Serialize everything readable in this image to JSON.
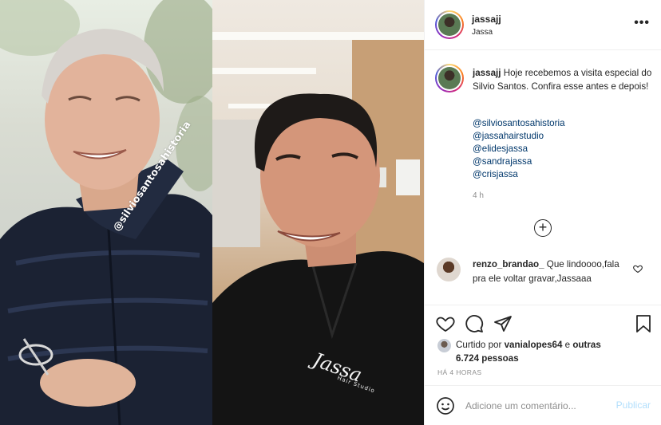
{
  "post": {
    "username": "jassajj",
    "location": "Jassa",
    "more_icon": "more-options-icon",
    "more_glyph": "•••"
  },
  "media": {
    "watermark_left": "@silviosantosahistoria",
    "brand_text": "Jassa",
    "brand_sub": "Hair Studio"
  },
  "caption": {
    "username": "jassajj",
    "text": "Hoje recebemos a visita especial do Silvio Santos. Confira esse antes e depois!",
    "mentions": [
      "@silviosantosahistoria",
      "@jassahairstudio",
      "@elidesjassa",
      "@sandrajassa",
      "@crisjassa"
    ],
    "time": "4 h"
  },
  "load_more_glyph": "+",
  "comment": {
    "username": "renzo_brandao_",
    "text": "Que lindoooo,fala pra ele voltar gravar,Jassaaa"
  },
  "likes": {
    "prefix": "Curtido por",
    "user": "vanialopes64",
    "mid": "e",
    "others": "outras 6.724 pessoas"
  },
  "posted_time": "HÁ 4 HORAS",
  "comment_box": {
    "placeholder": "Adicione um comentário...",
    "publish_label": "Publicar"
  },
  "colors": {
    "link": "#00376b",
    "publish_disabled": "#b2dffc",
    "muted": "#8e8e8e"
  }
}
